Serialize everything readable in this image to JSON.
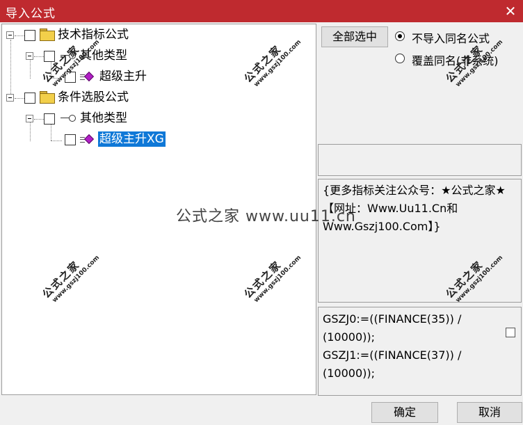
{
  "window": {
    "title": "导入公式",
    "close_glyph": "✕"
  },
  "tree": {
    "nodes": [
      {
        "label": "技术指标公式",
        "type": "folder"
      },
      {
        "label": "其他类型",
        "type": "category"
      },
      {
        "label": "超级主升",
        "type": "formula"
      },
      {
        "label": "条件选股公式",
        "type": "folder"
      },
      {
        "label": "其他类型",
        "type": "category"
      },
      {
        "label": "超级主升XG",
        "type": "formula",
        "selected": true
      }
    ]
  },
  "toolbar": {
    "select_all": "全部选中"
  },
  "options": [
    {
      "label": "不导入同名公式",
      "checked": true
    },
    {
      "label": "覆盖同名(非系统)",
      "checked": false
    }
  ],
  "description": {
    "text": "{更多指标关注公众号：★公式之家★ 【网址：Www.Uu11.Cn和Www.Gszj100.Com】}"
  },
  "code": {
    "lines": [
      "GSZJ0:=((FINANCE(35)) /",
      "(10000));",
      "GSZJ1:=((FINANCE(37)) /",
      "(10000));"
    ]
  },
  "watermark": {
    "text_cn": "公式之家",
    "text_url": "www.gszj100.com",
    "center_text": "公式之家 www.uu11.cn"
  },
  "buttons": {
    "ok": "确定",
    "cancel": "取消"
  },
  "colors": {
    "titlebar": "#bf2a2f",
    "selection": "#0f78d7",
    "gem": "#b11ec5"
  }
}
